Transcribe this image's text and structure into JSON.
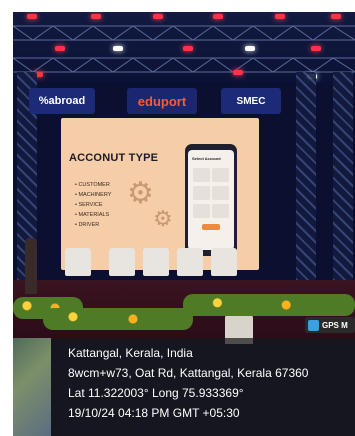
{
  "banners": {
    "left": "%abroad",
    "center": "eduport",
    "right": "SMEC"
  },
  "screen": {
    "title": "ACCONUT TYPE",
    "items": [
      "• CUSTOMER",
      "• MACHINERY",
      "• SERVICE",
      "• MATERIALS",
      "• DRIVER"
    ],
    "phone_title": "Select Account"
  },
  "gps": {
    "tag": "GPS M",
    "place": "Kattangal, Kerala, India",
    "address": "8wcm+w73, Oat Rd, Kattangal, Kerala 67360",
    "coords": "Lat 11.322003° Long 75.933369°",
    "datetime": "19/10/24 04:18 PM GMT +05:30"
  },
  "colors": {
    "banner": "#1b2b78",
    "screen": "#f5cda8",
    "overlay": "#191919"
  }
}
